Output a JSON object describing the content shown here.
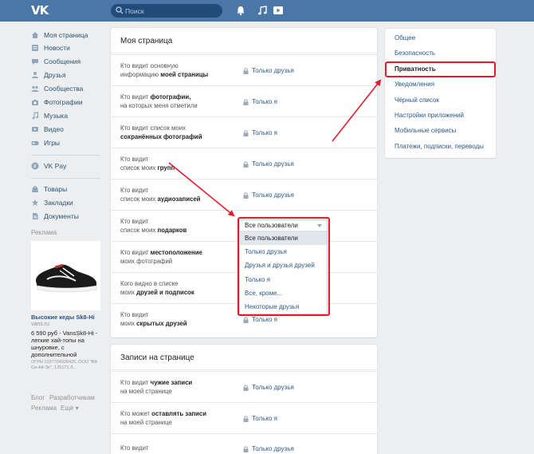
{
  "header": {
    "logo": "VK",
    "search_placeholder": "Поиск"
  },
  "left_menu": {
    "items": [
      {
        "label": "Моя страница",
        "icon": "home-icon"
      },
      {
        "label": "Новости",
        "icon": "news-icon"
      },
      {
        "label": "Сообщения",
        "icon": "messages-icon"
      },
      {
        "label": "Друзья",
        "icon": "friends-icon"
      },
      {
        "label": "Сообщества",
        "icon": "groups-icon"
      },
      {
        "label": "Фотографии",
        "icon": "camera-icon"
      },
      {
        "label": "Музыка",
        "icon": "music-icon"
      },
      {
        "label": "Видео",
        "icon": "video-icon"
      },
      {
        "label": "Игры",
        "icon": "games-icon"
      }
    ],
    "vkpay": {
      "label": "VK Pay",
      "icon": "vkpay-icon"
    },
    "extra": [
      {
        "label": "Товары",
        "icon": "goods-icon"
      },
      {
        "label": "Закладки",
        "icon": "bookmark-icon"
      },
      {
        "label": "Документы",
        "icon": "document-icon"
      }
    ]
  },
  "ad": {
    "title": "Реклама",
    "name": "Высокие кеды Sk8-Hi",
    "url": "vans.ru",
    "text": "6 590 руб - VansSk8-Hi - легкие хай-топы на шнуровке, с дополнительной",
    "legal": "ОГРН 1037704026425, ООО \"ВФ Си-Ай-Эс\", 125171 Л..."
  },
  "footer": {
    "blog": "Блог",
    "developers": "Разработчикам",
    "ads": "Реклама",
    "more": "Ещё"
  },
  "my_page": {
    "title": "Моя страница",
    "rows": [
      {
        "l1": "Кто видит основную",
        "l2a": "информацию ",
        "l2b": "моей страницы",
        "value": "Только друзья"
      },
      {
        "l1a": "Кто видит ",
        "l1b": "фотографии,",
        "l2": "на которых меня отметили",
        "value": "Только я"
      },
      {
        "l1": "Кто видит список моих",
        "l2b": "сохранённых фотографий",
        "value": "Только я"
      },
      {
        "l1": "Кто видит",
        "l2a": "список моих ",
        "l2b": "групп",
        "value": "Только друзья"
      },
      {
        "l1": "Кто видит",
        "l2a": "список моих ",
        "l2b": "аудиозаписей",
        "value": "Только друзья"
      },
      {
        "l1": "Кто видит",
        "l2a": "список моих ",
        "l2b": "подарков",
        "value": "Все пользователи"
      },
      {
        "l1a": "Кто видит ",
        "l1b": "местоположение",
        "l2": "моих фотографий",
        "value": "Только я"
      },
      {
        "l1": "Кого видно в списке",
        "l2a": "моих ",
        "l2b": "друзей и подписок",
        "value": "Только я"
      },
      {
        "l1": "Кто видит",
        "l2a": "моих ",
        "l2b": "скрытых друзей",
        "value": "Только я"
      }
    ]
  },
  "dropdown": {
    "selected": "Все пользователи",
    "options": [
      "Все пользователи",
      "Только друзья",
      "Друзья и друзья друзей",
      "Только я",
      "Все, кроме...",
      "Некоторые друзья"
    ]
  },
  "posts": {
    "title": "Записи на странице",
    "rows": [
      {
        "l1a": "Кто видит ",
        "l1b": "чужие записи",
        "l2": "на моей странице",
        "value": "Только друзья"
      },
      {
        "l1a": "Кто может ",
        "l1b": "оставлять записи",
        "l2": "на моей странице",
        "value": "Только я"
      },
      {
        "l1": "Кто видит",
        "l2": "",
        "value": "Только друзья"
      }
    ]
  },
  "right_menu": {
    "items": [
      "Общее",
      "Безопасность",
      "Приватность",
      "Уведомления",
      "Чёрный список",
      "Настройки приложений",
      "Мобильные сервисы",
      "Платежи, подписки, переводы"
    ],
    "active_index": 2
  },
  "colors": {
    "header": "#4a76a8",
    "link": "#2a5885",
    "highlight": "#e11d2d"
  }
}
